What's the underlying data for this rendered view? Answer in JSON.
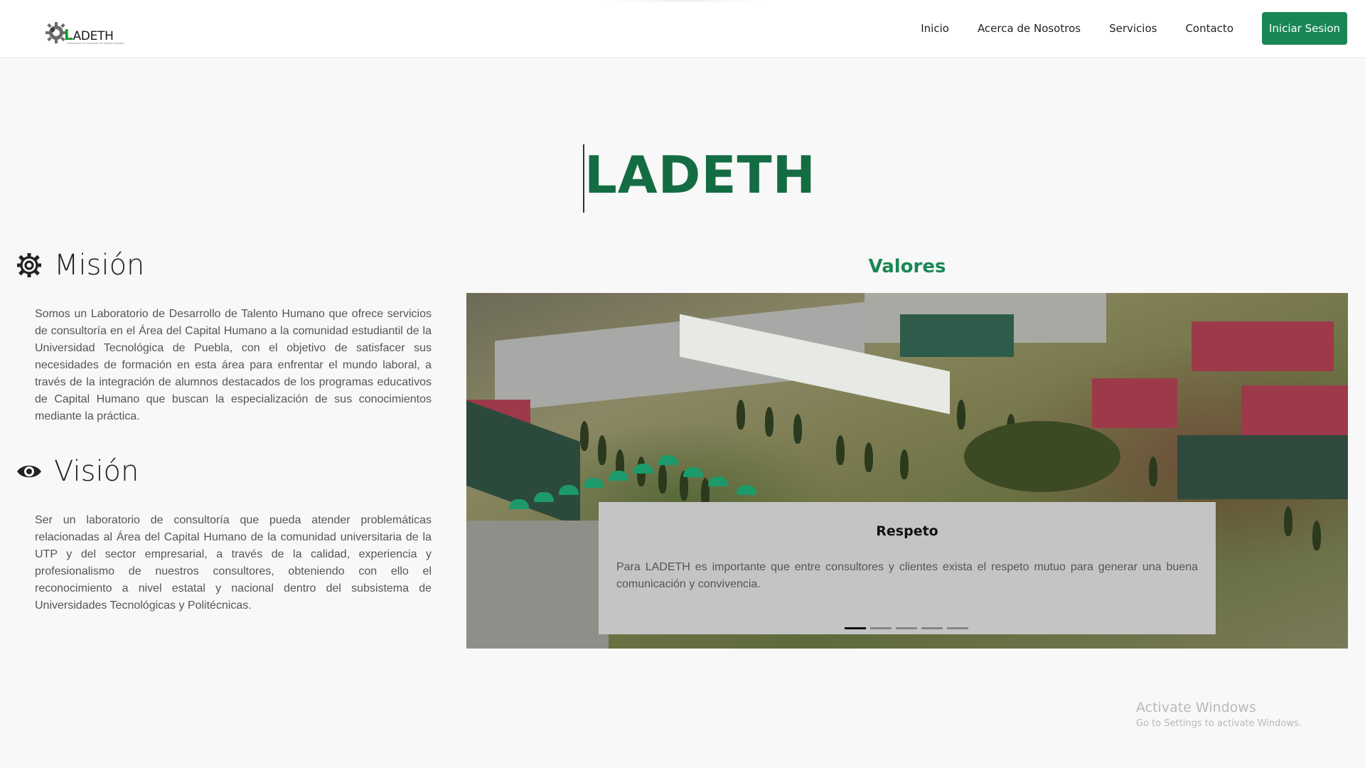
{
  "brand": {
    "name_letter": "L",
    "name_rest": "ADETH",
    "tagline": "Laboratorio de Desarrollo de Talento Humano"
  },
  "nav": {
    "items": [
      {
        "label": "Inicio"
      },
      {
        "label": "Acerca de Nosotros"
      },
      {
        "label": "Servicios"
      },
      {
        "label": "Contacto"
      }
    ],
    "login_label": "Iniciar Sesion"
  },
  "hero": {
    "title": "LADETH"
  },
  "mision": {
    "heading": "Misión",
    "icon": "gear-icon",
    "text": "Somos un Laboratorio de Desarrollo de Talento Humano que ofrece servicios de consultoría en el Área del Capital Humano a la comunidad estudiantil de la Universidad Tecnológica de Puebla, con el objetivo de satisfacer sus necesidades de formación en esta área para enfrentar el mundo laboral, a través de la integración de alumnos destacados de los programas educativos de Capital Humano que buscan la especialización de sus conocimientos mediante la práctica."
  },
  "vision": {
    "heading": "Visión",
    "icon": "eye-icon",
    "text": "Ser un laboratorio de consultoría que pueda atender problemáticas relacionadas al Área del Capital Humano de la comunidad universitaria de la UTP y del sector empresarial, a través de la calidad, experiencia y profesionalismo de nuestros consultores, obteniendo con ello el reconocimiento a nivel estatal y nacional dentro del subsistema de Universidades Tecnológicas y Politécnicas."
  },
  "valores": {
    "heading": "Valores",
    "slide": {
      "title": "Respeto",
      "text": "Para LADETH es importante que entre consultores y clientes exista el respeto mutuo para generar una buena comunicación y convivencia."
    },
    "slide_count": 5,
    "active_slide": 1
  },
  "watermark": {
    "title": "Activate Windows",
    "subtitle": "Go to Settings to activate Windows."
  },
  "colors": {
    "primary_green": "#198754",
    "title_green": "#146c43",
    "background": "#f8f8f8",
    "caption_bg": "#c4c4c4"
  }
}
